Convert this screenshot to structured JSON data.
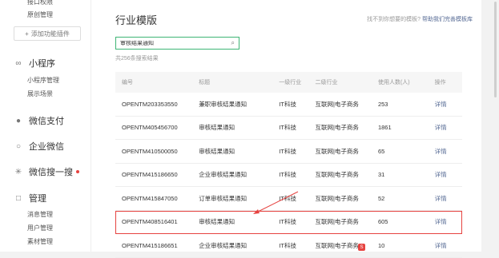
{
  "sidebar": {
    "top_items": [
      "接口权限",
      "原创管理"
    ],
    "add_plugin": "添加功能插件",
    "mini_program": {
      "title": "小程序",
      "items": [
        "小程序管理",
        "展示场景"
      ]
    },
    "wechat_pay": "微信支付",
    "work_wechat": "企业微信",
    "wechat_search": "微信搜一搜",
    "manage": {
      "title": "管理",
      "items": [
        "消息管理",
        "用户管理",
        "素材管理"
      ]
    }
  },
  "main": {
    "title": "行业模版",
    "top_link_prefix": "找不到你想要的模板?",
    "top_link": "帮助我们完善模板库",
    "search_value": "审核结果通知",
    "result_count": "共256条搜索结果",
    "columns": [
      "编号",
      "标题",
      "一级行业",
      "二级行业",
      "使用人数(人)",
      "操作"
    ],
    "rows": [
      {
        "id": "OPENTM203353550",
        "title": "兼职审核结果通知",
        "industry1": "IT科技",
        "industry2": "互联网|电子商务",
        "users": "253",
        "action": "详情"
      },
      {
        "id": "OPENTM405456700",
        "title": "审核结果通知",
        "industry1": "IT科技",
        "industry2": "互联网|电子商务",
        "users": "1861",
        "action": "详情"
      },
      {
        "id": "OPENTM410500050",
        "title": "审核结果通知",
        "industry1": "IT科技",
        "industry2": "互联网|电子商务",
        "users": "65",
        "action": "详情"
      },
      {
        "id": "OPENTM415186650",
        "title": "企业审核结果通知",
        "industry1": "IT科技",
        "industry2": "互联网|电子商务",
        "users": "31",
        "action": "详情"
      },
      {
        "id": "OPENTM415847050",
        "title": "订单审核结果通知",
        "industry1": "IT科技",
        "industry2": "互联网|电子商务",
        "users": "52",
        "action": "详情"
      },
      {
        "id": "OPENTM408516401",
        "title": "审核结果通知",
        "industry1": "IT科技",
        "industry2": "互联网|电子商务",
        "users": "605",
        "action": "详情"
      },
      {
        "id": "OPENTM415186651",
        "title": "企业审核结果通知",
        "industry1": "IT科技",
        "industry2": "互联网|电子商务",
        "users": "10",
        "action": "详情"
      }
    ]
  },
  "colors": {
    "accent_green": "#3eb575",
    "link_blue": "#576b95",
    "highlight_red": "#e64340"
  }
}
